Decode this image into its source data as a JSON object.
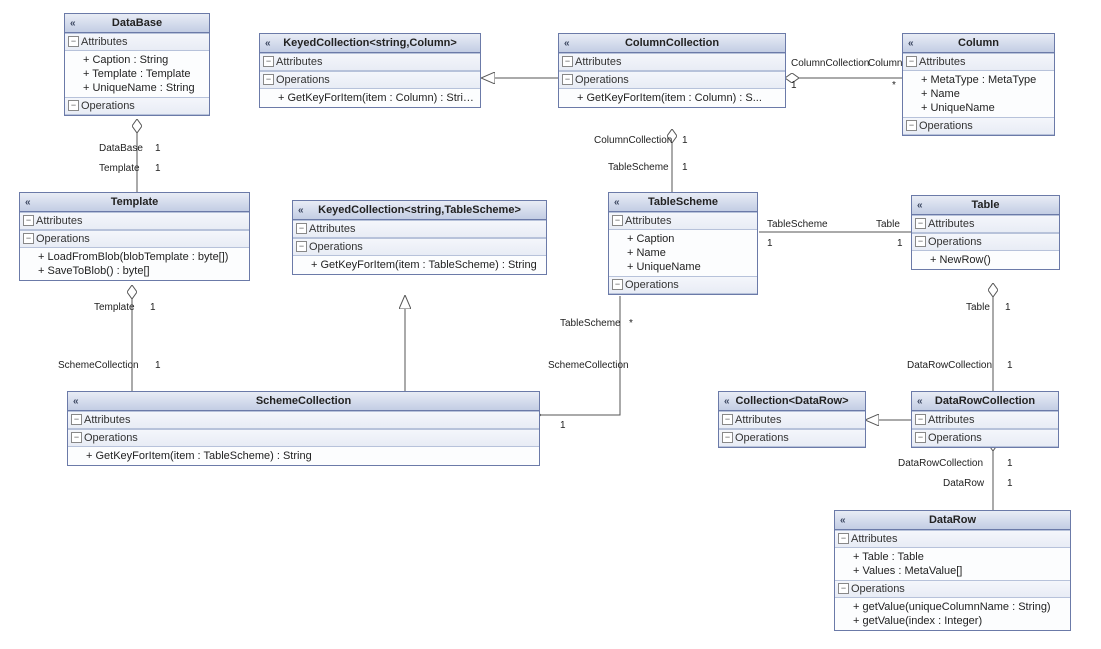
{
  "classes": {
    "database": {
      "name": "DataBase",
      "attributes": [
        "+ Caption : String",
        "+ Template : Template",
        "+ UniqueName : String"
      ],
      "operations": []
    },
    "keyedCollectionColumn": {
      "name": "KeyedCollection<string,Column>",
      "attributes": [],
      "operations": [
        "+ GetKeyForItem(item : Column) : String"
      ]
    },
    "columnCollection": {
      "name": "ColumnCollection",
      "attributes": [],
      "operations": [
        "+ GetKeyForItem(item : Column) : S..."
      ]
    },
    "column": {
      "name": "Column",
      "attributes": [
        "+ MetaType : MetaType",
        "+ Name",
        "+ UniqueName"
      ],
      "operations": []
    },
    "template": {
      "name": "Template",
      "attributes": [],
      "operations": [
        "+ LoadFromBlob(blobTemplate : byte[])",
        "+ SaveToBlob() : byte[]"
      ]
    },
    "keyedCollectionTableScheme": {
      "name": "KeyedCollection<string,TableScheme>",
      "attributes": [],
      "operations": [
        "+ GetKeyForItem(item : TableScheme) : String"
      ]
    },
    "tableScheme": {
      "name": "TableScheme",
      "attributes": [
        "+ Caption",
        "+ Name",
        "+ UniqueName"
      ],
      "operations": []
    },
    "table": {
      "name": "Table",
      "attributes": [],
      "operations": [
        "+ NewRow()"
      ]
    },
    "schemeCollection": {
      "name": "SchemeCollection",
      "attributes": [],
      "operations": [
        "+ GetKeyForItem(item : TableScheme) : String"
      ]
    },
    "collectionDataRow": {
      "name": "Collection<DataRow>",
      "attributes": [],
      "operations": []
    },
    "dataRowCollection": {
      "name": "DataRowCollection",
      "attributes": [],
      "operations": []
    },
    "dataRow": {
      "name": "DataRow",
      "attributes": [
        "+ Table : Table",
        "+ Values : MetaValue[]"
      ],
      "operations": [
        "+ getValue(uniqueColumnName : String)",
        "+ getValue(index : Integer)"
      ]
    }
  },
  "labels": {
    "attributes": "Attributes",
    "operations": "Operations",
    "columnCollection": "ColumnCollection",
    "column": "Column",
    "one": "1",
    "star": "*",
    "database": "DataBase",
    "template": "Template",
    "tableScheme": "TableScheme",
    "schemeCollection": "SchemeCollection",
    "table": "Table",
    "dataRowCollection": "DataRowCollection",
    "dataRow": "DataRow"
  }
}
